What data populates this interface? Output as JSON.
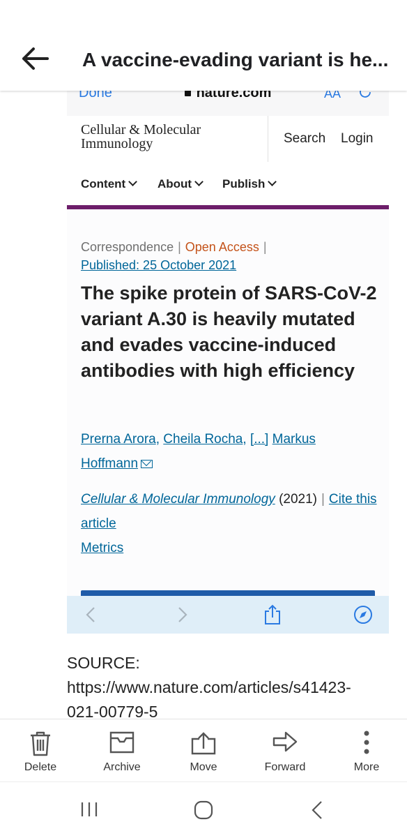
{
  "appbar": {
    "title": "A vaccine-evading variant is he..."
  },
  "safari": {
    "done": "Done",
    "domain": "nature.com",
    "text_size": "AA"
  },
  "site": {
    "journal_line1": "Cellular & Molecular",
    "journal_line2": "Immunology",
    "search": "Search",
    "login": "Login"
  },
  "nav": {
    "items": [
      "Content",
      "About",
      "Publish"
    ]
  },
  "article": {
    "type": "Correspondence",
    "access": "Open Access",
    "published": "Published: 25 October 2021",
    "title": "The spike protein of SARS-CoV-2 variant A.30 is heavily mutated and evades vaccine-induced antibodies with high efficiency",
    "authors": [
      "Prerna Arora",
      "Cheila Rocha",
      "[...]",
      "Markus Hoffmann"
    ],
    "journal": "Cellular & Molecular Immunology",
    "year": "(2021)",
    "cite": "Cite this article",
    "metrics": "Metrics"
  },
  "source": {
    "label": "SOURCE:",
    "url_line1": "https://www.nature.com/articles/s41423-",
    "url_line2": "021-00779-5"
  },
  "actions": [
    "Delete",
    "Archive",
    "Move",
    "Forward",
    "More"
  ],
  "colors": {
    "link": "#006699",
    "open_access": "#c4531a",
    "journal_rule": "#6d1e6a",
    "safari_blue": "#2a7ae2"
  }
}
